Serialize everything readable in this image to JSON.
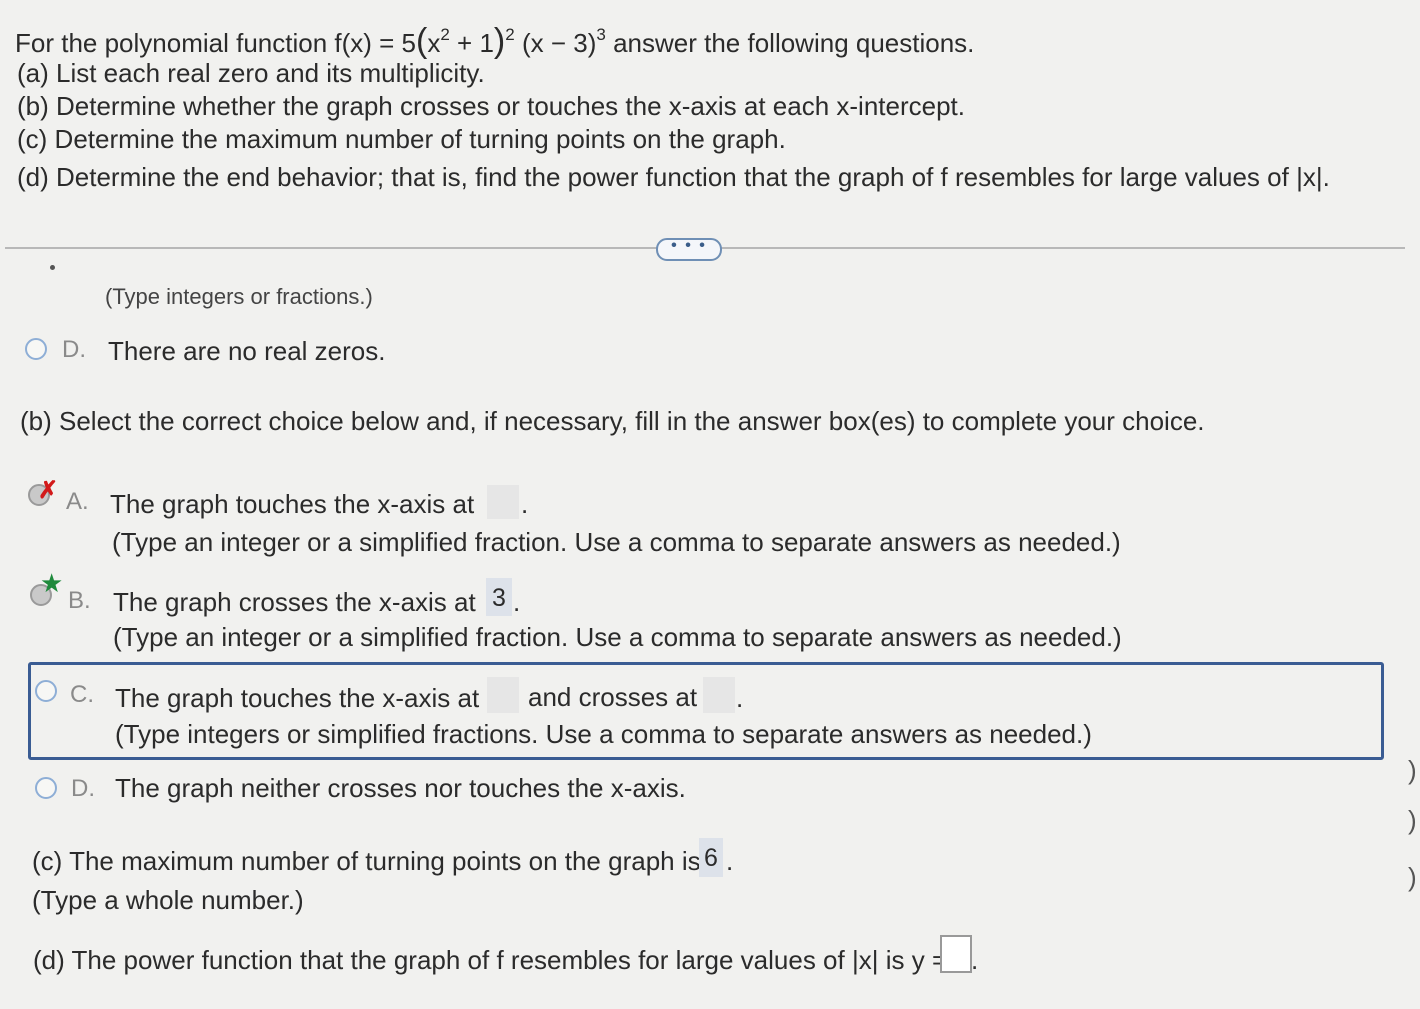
{
  "question": {
    "intro": "For the polynomial function f(x) = 5",
    "factor1": "x",
    "factor1_exp": "2",
    "factor1_tail": " + 1",
    "outer_exp": "2",
    "factor2": "(x − 3)",
    "factor2_exp": "3",
    "after": "answer the following questions.",
    "part_a": "(a) List each real zero and its multiplicity.",
    "part_b": "(b) Determine whether the graph crosses or touches the x-axis at each x-intercept.",
    "part_c": "(c) Determine the maximum number of turning points on the graph.",
    "part_d_pre": "(d) Determine the end behavior; that is, find the power function that the graph of f resembles for large values of",
    "part_d_abs": "x"
  },
  "more_button": "• • •",
  "part_a_partial": {
    "hint": "(Type integers or fractions.)",
    "option_d_letter": "D.",
    "option_d_text": "There are no real zeros."
  },
  "part_b": {
    "prompt": "(b) Select the correct choice below and, if necessary, fill in the answer box(es) to complete your choice.",
    "options": [
      {
        "letter": "A.",
        "text": "The graph touches the x-axis at",
        "answer": "",
        "hint": "(Type an integer or a simplified fraction. Use a comma to separate answers as needed.)",
        "status": "incorrect"
      },
      {
        "letter": "B.",
        "text": "The graph crosses the x-axis at",
        "answer": "3",
        "hint": "(Type an integer or a simplified fraction. Use a comma to separate answers as needed.)",
        "status": "correct"
      },
      {
        "letter": "C.",
        "text": "The graph touches the x-axis at",
        "mid": "and crosses at",
        "hint": "(Type integers or simplified fractions. Use a comma to separate answers as needed.)",
        "status": "selected"
      },
      {
        "letter": "D.",
        "text": "The graph neither crosses nor touches the x-axis."
      }
    ]
  },
  "part_c": {
    "text": "(c) The maximum number of turning points on the graph is",
    "answer": "6",
    "hint": "(Type a whole number.)"
  },
  "part_d": {
    "text_pre": "(d) The power function that the graph of f resembles for large values of",
    "abs_var": "x",
    "text_post": "is y ="
  },
  "colors": {
    "background": "#f1f1ef",
    "selected_frame": "#3a5c93",
    "incorrect_mark": "#d21a1a",
    "correct_mark": "#1f8a3c",
    "answer_box": "#dde2ea"
  }
}
